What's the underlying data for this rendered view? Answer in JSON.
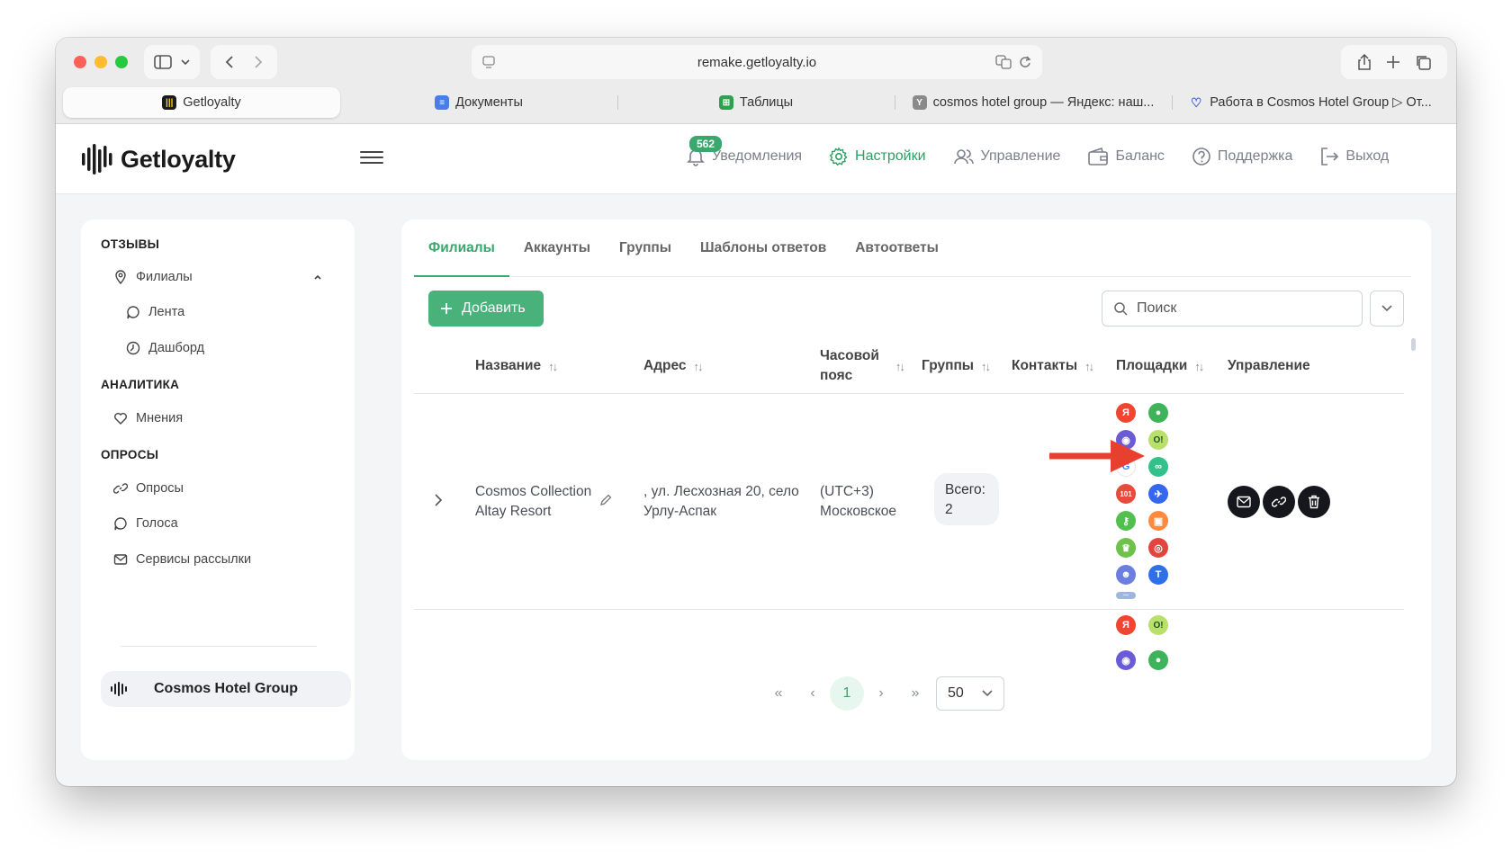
{
  "browser": {
    "url": "remake.getloyalty.io",
    "tabs": [
      {
        "label": "Getloyalty",
        "icon": "getloyalty-icon",
        "active": true
      },
      {
        "label": "Документы",
        "icon": "docs-icon"
      },
      {
        "label": "Таблицы",
        "icon": "sheets-icon"
      },
      {
        "label": "cosmos hotel group — Яндекс: наш...",
        "icon": "yandex-icon"
      },
      {
        "label": "Работа в Cosmos Hotel Group ▷ От...",
        "icon": "heart-icon"
      }
    ]
  },
  "header": {
    "logo": "Getloyalty",
    "nav": [
      {
        "label": "Уведомления",
        "icon": "bell-icon",
        "badge": "562"
      },
      {
        "label": "Настройки",
        "icon": "gear-icon",
        "active": true
      },
      {
        "label": "Управление",
        "icon": "users-icon"
      },
      {
        "label": "Баланс",
        "icon": "wallet-icon"
      },
      {
        "label": "Поддержка",
        "icon": "help-icon"
      },
      {
        "label": "Выход",
        "icon": "logout-icon"
      }
    ]
  },
  "sidebar": {
    "section_reviews": "ОТЗЫВЫ",
    "branches": "Филиалы",
    "feed": "Лента",
    "dashboard": "Дашборд",
    "section_analytics": "АНАЛИТИКА",
    "opinions": "Мнения",
    "section_surveys": "ОПРОСЫ",
    "surveys": "Опросы",
    "votes": "Голоса",
    "mailing": "Сервисы рассылки",
    "org": "Cosmos Hotel Group"
  },
  "main": {
    "tabs": [
      "Филиалы",
      "Аккаунты",
      "Группы",
      "Шаблоны ответов",
      "Автоответы"
    ],
    "add_label": "Добавить",
    "search_placeholder": "Поиск",
    "columns": {
      "name": "Название",
      "address": "Адрес",
      "tz_line1": "Часовой",
      "tz_line2": "пояс",
      "groups": "Группы",
      "contacts": "Контакты",
      "platforms": "Площадки",
      "manage": "Управление"
    },
    "row": {
      "name_line1": "Cosmos Collection",
      "name_line2": "Altay Resort",
      "addr_line1": ", ул. Лесхозная 20, село",
      "addr_line2": "Урлу-Аспак",
      "tz_line1": "(UTC+3)",
      "tz_line2": "Московское",
      "groups_label": "Всего:",
      "groups_count": "2"
    },
    "platforms": [
      {
        "icon": "yandex-icon",
        "color": "#f0452f",
        "glyph": "Я"
      },
      {
        "icon": "twogis-icon",
        "color": "#3eb35a",
        "glyph": "●"
      },
      {
        "icon": "globe-icon",
        "color": "#6a5bd6",
        "glyph": "◉"
      },
      {
        "icon": "otzovik-icon",
        "color": "#b9e06a",
        "glyph": "O!"
      },
      {
        "icon": "google-icon",
        "color": "#ffffff",
        "glyph": "G"
      },
      {
        "icon": "tripadvisor-icon",
        "color": "#34c08a",
        "glyph": "∞"
      },
      {
        "icon": "hotel101-icon",
        "color": "#e84a3c",
        "glyph": "101"
      },
      {
        "icon": "plane-icon",
        "color": "#3466f0",
        "glyph": "✈"
      },
      {
        "icon": "key-icon",
        "color": "#52c04e",
        "glyph": "⚷"
      },
      {
        "icon": "orange-icon",
        "color": "#ff8a3d",
        "glyph": "▣"
      },
      {
        "icon": "crown-icon",
        "color": "#6cc24a",
        "glyph": "♛"
      },
      {
        "icon": "target-icon",
        "color": "#e0453f",
        "glyph": "◎"
      },
      {
        "icon": "person-icon",
        "color": "#6c7fe0",
        "glyph": "☻"
      },
      {
        "icon": "tbank-icon",
        "color": "#2f6fe8",
        "glyph": "T"
      },
      {
        "icon": "small-logo-icon",
        "color": "#9fb6d9",
        "glyph": "—"
      }
    ],
    "row2_platforms": [
      {
        "icon": "yandex-icon",
        "color": "#f0452f",
        "glyph": "Я"
      },
      {
        "icon": "otzovik-icon",
        "color": "#b9e06a",
        "glyph": "O!"
      },
      {
        "icon": "globe-icon",
        "color": "#6a5bd6",
        "glyph": "◉"
      },
      {
        "icon": "twogis-icon",
        "color": "#3eb35a",
        "glyph": "●"
      }
    ],
    "pagination": {
      "current": "1",
      "per_page": "50"
    }
  }
}
